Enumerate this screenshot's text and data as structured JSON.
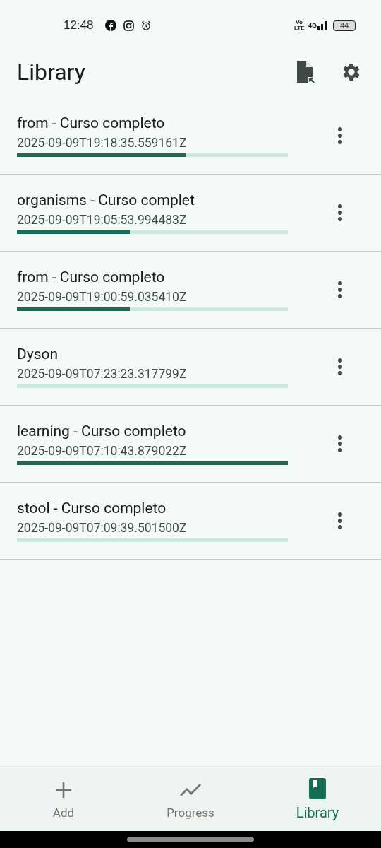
{
  "status_bar": {
    "time": "12:48",
    "volte": "Vo LTE",
    "network": "4G",
    "battery": "44"
  },
  "app_bar": {
    "title": "Library"
  },
  "items": [
    {
      "title": "from - Curso completo",
      "timestamp": "2025-09-09T19:18:35.559161Z",
      "level": 0.625
    },
    {
      "title": "organisms - Curso complet",
      "timestamp": "2025-09-09T19:05:53.994483Z",
      "level": 0.417
    },
    {
      "title": "from - Curso completo",
      "timestamp": "2025-09-09T19:00:59.035410Z",
      "level": 0.417
    },
    {
      "title": "Dyson",
      "timestamp": "2025-09-09T07:23:23.317799Z",
      "level": 0
    },
    {
      "title": "learning - Curso completo",
      "timestamp": "2025-09-09T07:10:43.879022Z",
      "level": 1
    },
    {
      "title": "stool - Curso completo",
      "timestamp": "2025-09-09T07:09:39.501500Z",
      "level": 0
    }
  ],
  "nav": [
    {
      "kind": "add",
      "label": "Add",
      "selected": false
    },
    {
      "kind": "progress",
      "label": "Progress",
      "selected": false
    },
    {
      "kind": "library",
      "label": "Library",
      "selected": true
    }
  ]
}
